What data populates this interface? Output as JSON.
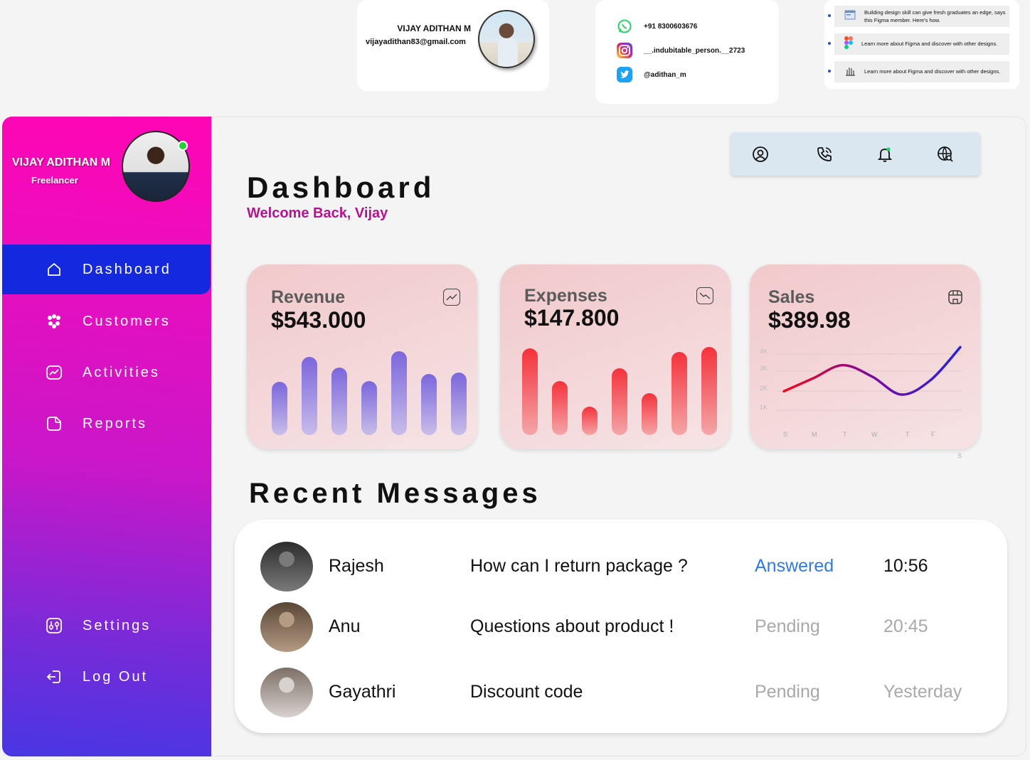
{
  "profile_card": {
    "name": "VIJAY ADITHAN M",
    "email": "vijayadithan83@gmail.com"
  },
  "social": [
    {
      "icon": "whatsapp-icon",
      "text": "+91 8300603676"
    },
    {
      "icon": "instagram-icon",
      "text": "__.indubitable_person.__2723"
    },
    {
      "icon": "twitter-icon",
      "text": "@adithan_m"
    }
  ],
  "news": [
    {
      "icon": "browser-window-icon",
      "text": "Building design skill can give fresh graduates an edge, says this Figma member. Here's  how."
    },
    {
      "icon": "figma-icon",
      "text": "Learn more about  Figma and discover with other designs."
    },
    {
      "icon": "hand-icon",
      "text": "Learn more about  Figma and discover with other designs."
    }
  ],
  "sidebar": {
    "name": "VIJAY ADITHAN M",
    "role": "Freelancer",
    "online": true,
    "items": [
      {
        "label": "Dashboard",
        "icon": "home-icon",
        "active": true
      },
      {
        "label": "Customers",
        "icon": "customers-icon",
        "active": false
      },
      {
        "label": "Activities",
        "icon": "activity-chart-icon",
        "active": false
      },
      {
        "label": "Reports",
        "icon": "reports-icon",
        "active": false
      }
    ],
    "bottom_items": [
      {
        "label": "Settings",
        "icon": "settings-icon"
      },
      {
        "label": "Log Out",
        "icon": "logout-icon"
      }
    ]
  },
  "toolbar": {
    "icons": [
      "user-icon",
      "phone-icon",
      "bell-icon",
      "globe-search-icon"
    ]
  },
  "header": {
    "title": "Dashboard",
    "welcome": "Welcome Back, Vijay"
  },
  "stats": {
    "revenue": {
      "label": "Revenue",
      "value": "$543.000",
      "icon": "trend-up-icon"
    },
    "expenses": {
      "label": "Expenses",
      "value": "$147.800",
      "icon": "trend-down-icon"
    },
    "sales": {
      "label": "Sales",
      "value": "$389.98",
      "icon": "store-icon"
    }
  },
  "chart_data": [
    {
      "type": "bar",
      "title": "Revenue",
      "values": [
        75,
        110,
        95,
        76,
        118,
        86,
        88
      ]
    },
    {
      "type": "bar",
      "title": "Expenses",
      "values": [
        122,
        76,
        40,
        94,
        59,
        117,
        124
      ]
    },
    {
      "type": "line",
      "title": "Sales",
      "categories": [
        "S",
        "M",
        "T",
        "W",
        "T",
        "F",
        "S"
      ],
      "yticks": [
        "4K",
        "3K",
        "2K",
        "1K"
      ],
      "ylim": [
        0,
        4
      ],
      "x": [
        0,
        1,
        2,
        3,
        4,
        5,
        6
      ],
      "values": [
        1.2,
        2.0,
        2.8,
        2.1,
        1.0,
        1.9,
        3.9
      ],
      "gradient": [
        "#ee0c1c",
        "#7a0c9c",
        "#2323d8"
      ]
    }
  ],
  "recent": {
    "title": "Recent Messages",
    "messages": [
      {
        "name": "Rajesh",
        "subject": "How can I return package ?",
        "status": "Answered",
        "time": "10:56",
        "status_color": "#2f7ce0",
        "time_color": "#111111",
        "avatar_colors": [
          "#2b2b2b",
          "#7a7a7a"
        ]
      },
      {
        "name": "Anu",
        "subject": "Questions about product !",
        "status": "Pending",
        "time": "20:45",
        "status_color": "#a9a9a9",
        "time_color": "#a9a9a9",
        "avatar_colors": [
          "#5a4636",
          "#b39b84"
        ]
      },
      {
        "name": "Gayathri",
        "subject": "Discount code",
        "status": "Pending",
        "time": "Yesterday",
        "status_color": "#a9a9a9",
        "time_color": "#a9a9a9",
        "avatar_colors": [
          "#7d6f67",
          "#d8d2cf"
        ]
      }
    ]
  }
}
